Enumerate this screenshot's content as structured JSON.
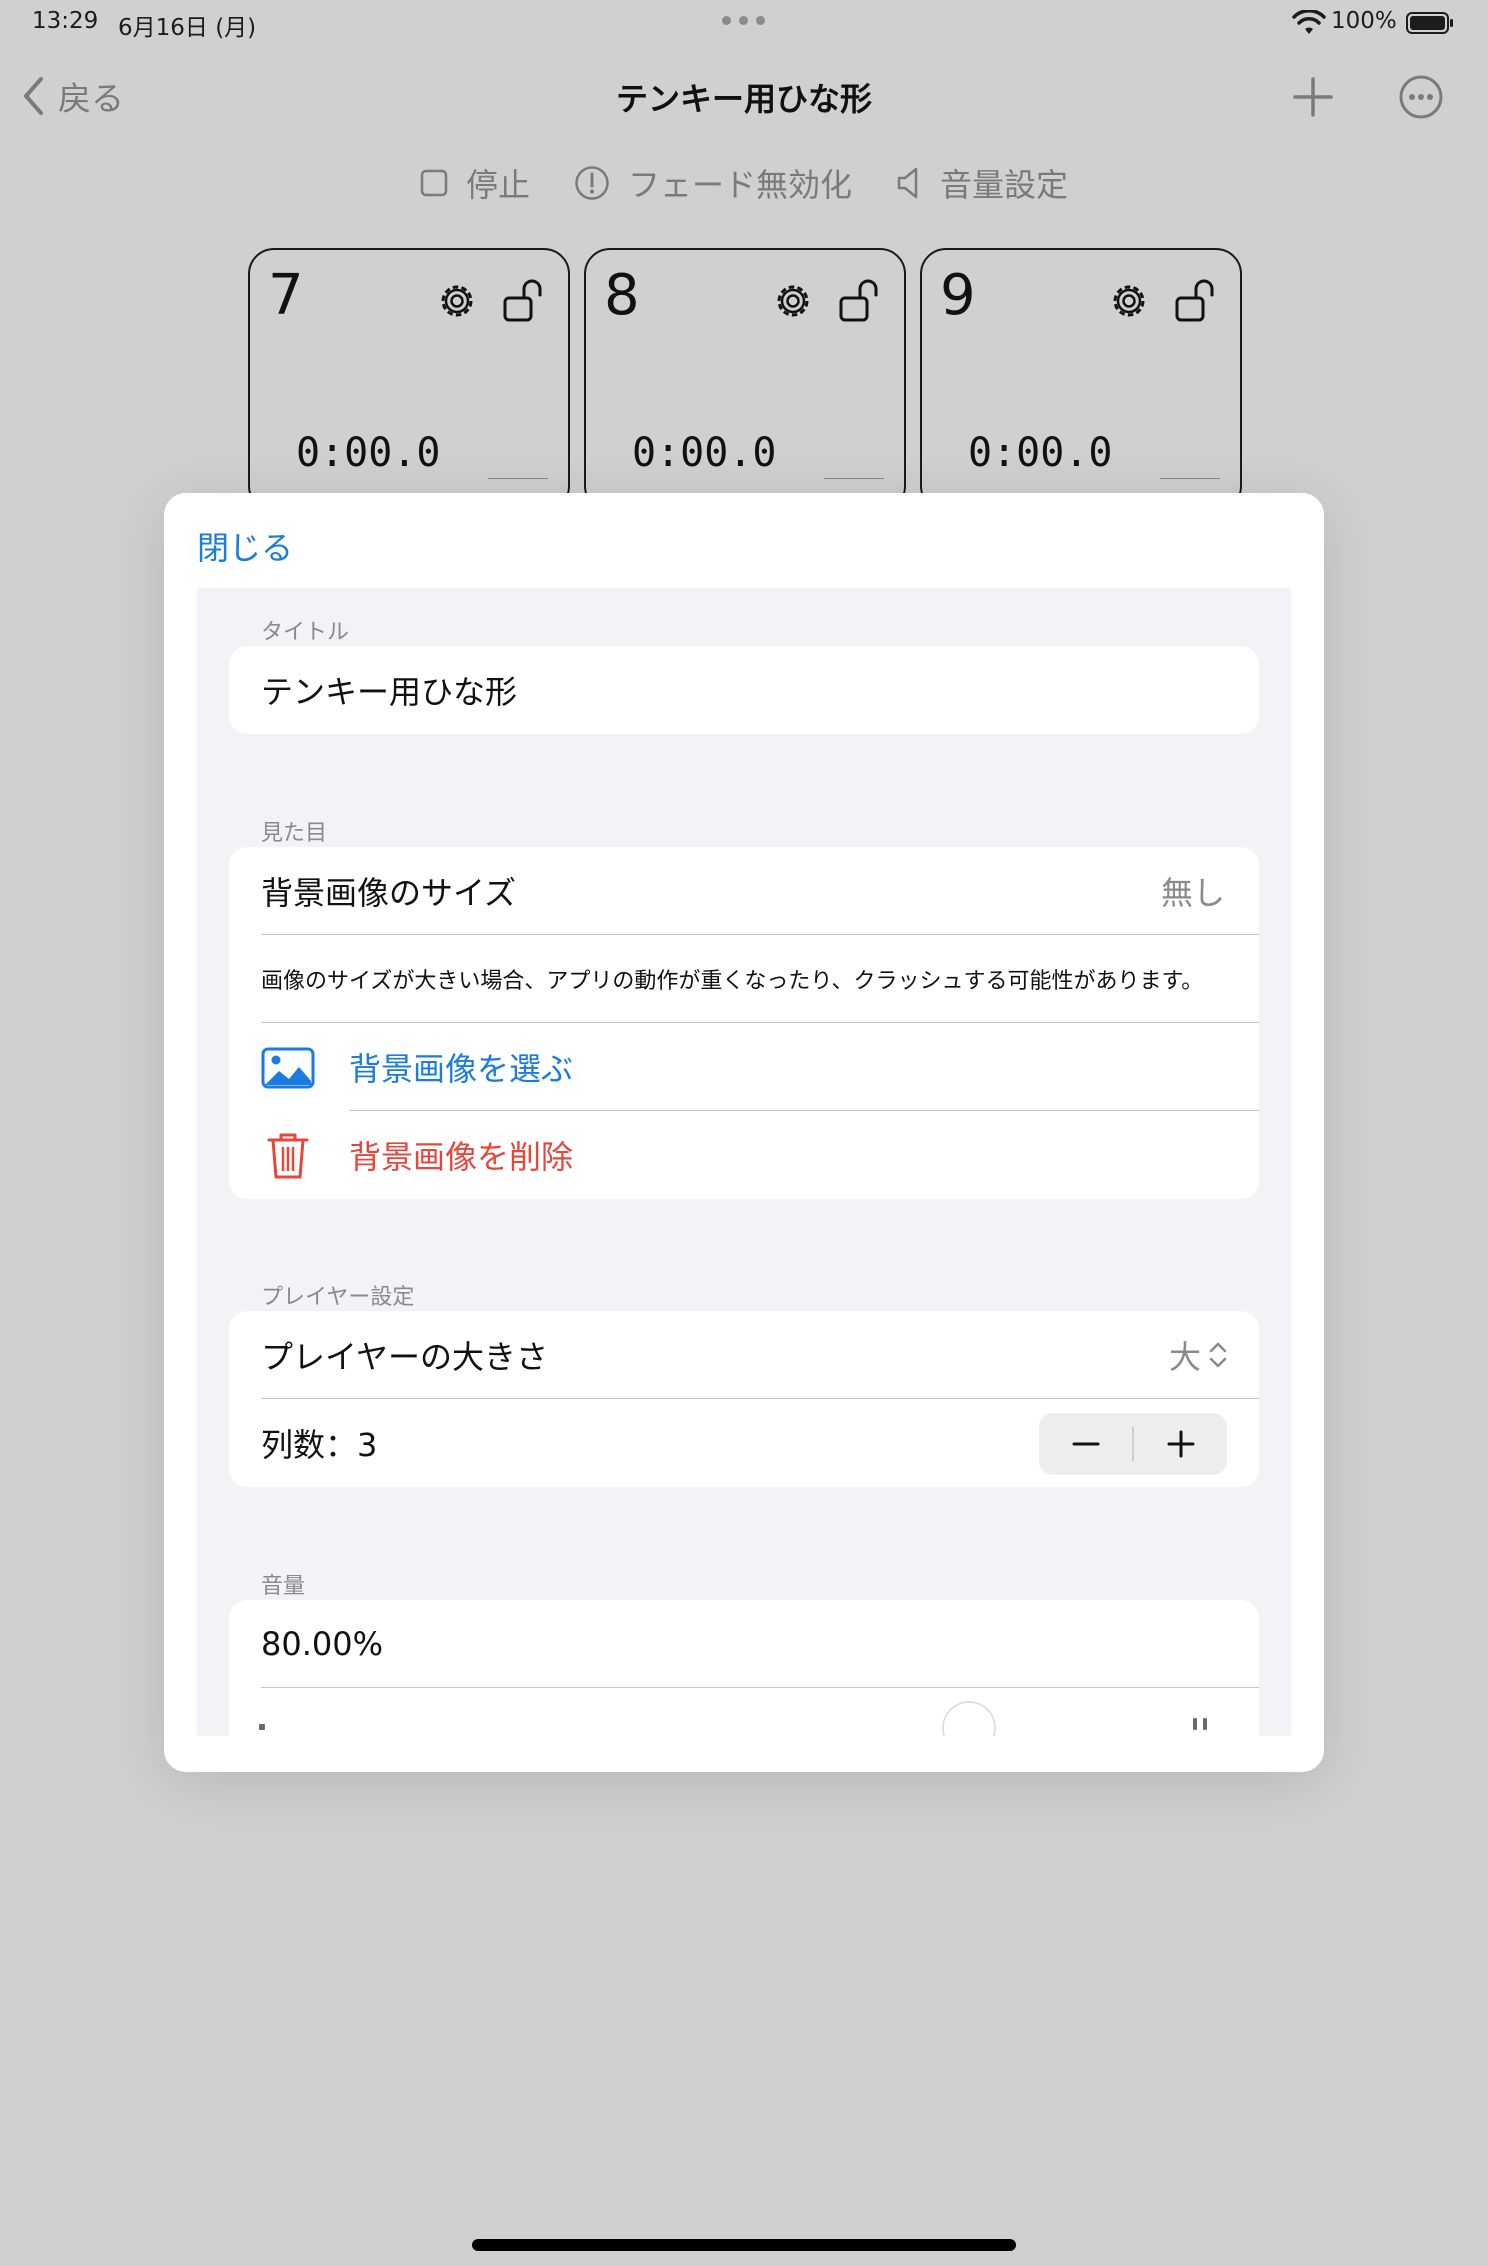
{
  "status_bar": {
    "time": "13:29",
    "date": "6月16日 (月)",
    "battery_percent": "100%"
  },
  "nav": {
    "back_label": "戻る",
    "title": "テンキー用ひな形"
  },
  "toolbar": {
    "stop_label": "停止",
    "fade_label": "フェード無効化",
    "volume_label": "音量設定"
  },
  "players": [
    {
      "number": "7",
      "time": "0:00.0"
    },
    {
      "number": "8",
      "time": "0:00.0"
    },
    {
      "number": "9",
      "time": "0:00.0"
    }
  ],
  "sheet": {
    "close_label": "閉じる",
    "title_section": {
      "header": "タイトル",
      "value": "テンキー用ひな形"
    },
    "appearance_section": {
      "header": "見た目",
      "bg_size_label": "背景画像のサイズ",
      "bg_size_value": "無し",
      "note": "画像のサイズが大きい場合、アプリの動作が重くなったり、クラッシュする可能性があります。",
      "choose_bg_label": "背景画像を選ぶ",
      "delete_bg_label": "背景画像を削除"
    },
    "player_section": {
      "header": "プレイヤー設定",
      "size_label": "プレイヤーの大きさ",
      "size_value": "大",
      "columns_label": "列数：3"
    },
    "volume_section": {
      "header": "音量",
      "value": "80.00%"
    }
  },
  "colors": {
    "accent_blue": "#1a7ce0",
    "destructive_red": "#e8453c",
    "backdrop": "#d0d0d0",
    "grouped_bg": "#f2f2f7"
  },
  "icons": {
    "back": "chevron-left-icon",
    "add": "plus-icon",
    "more": "ellipsis-circle-icon",
    "stop": "stop-square-icon",
    "fade": "exclamation-circle-icon",
    "volume": "speaker-icon",
    "settings": "gear-icon",
    "lock": "unlock-icon",
    "photo": "photo-icon",
    "trash": "trash-icon"
  }
}
